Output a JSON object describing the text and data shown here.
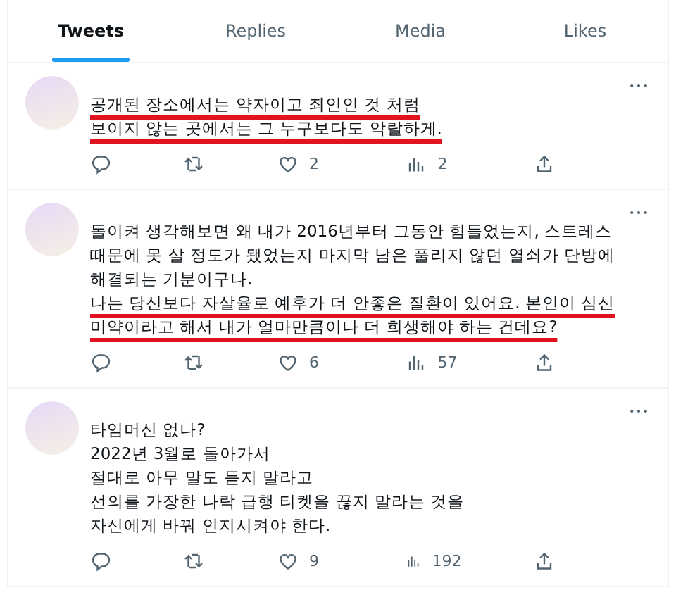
{
  "tabs": [
    {
      "label": "Tweets",
      "selected": true
    },
    {
      "label": "Replies",
      "selected": false
    },
    {
      "label": "Media",
      "selected": false
    },
    {
      "label": "Likes",
      "selected": false
    }
  ],
  "tweets": [
    {
      "paragraphs": [
        {
          "lines": [
            "공개된 장소에서는 약자이고 죄인인 것 처럼",
            "보이지 않는 곳에서는 그 누구보다도 악랄하게."
          ],
          "underlined": true
        }
      ],
      "likes": "2",
      "views": "2"
    },
    {
      "paragraphs": [
        {
          "lines": [
            "돌이켜 생각해보면 왜 내가 2016년부터 그동안 힘들었는지, 스트레스 때문에 못 살 정도가 됐었는지 마지막 남은 풀리지 않던 열쇠가 단방에 해결되는 기분이구나."
          ],
          "underlined": false
        },
        {
          "lines": [
            "나는 당신보다 자살율로 예후가 더 안좋은 질환이 있어요. 본인이 심신미약이라고 해서 내가 얼마만큼이나 더 희생해야 하는 건데요?"
          ],
          "underlined": true
        }
      ],
      "likes": "6",
      "views": "57"
    },
    {
      "paragraphs": [
        {
          "lines": [
            "타임머신 없나?",
            "2022년 3월로 돌아가서",
            "절대로 아무 말도 듣지 말라고",
            "선의를 가장한 나락 급행 티켓을 끊지 말라는 것을",
            "자신에게 바꿔 인지시켜야 한다."
          ],
          "underlined": false
        }
      ],
      "likes": "9",
      "views": "192"
    }
  ]
}
